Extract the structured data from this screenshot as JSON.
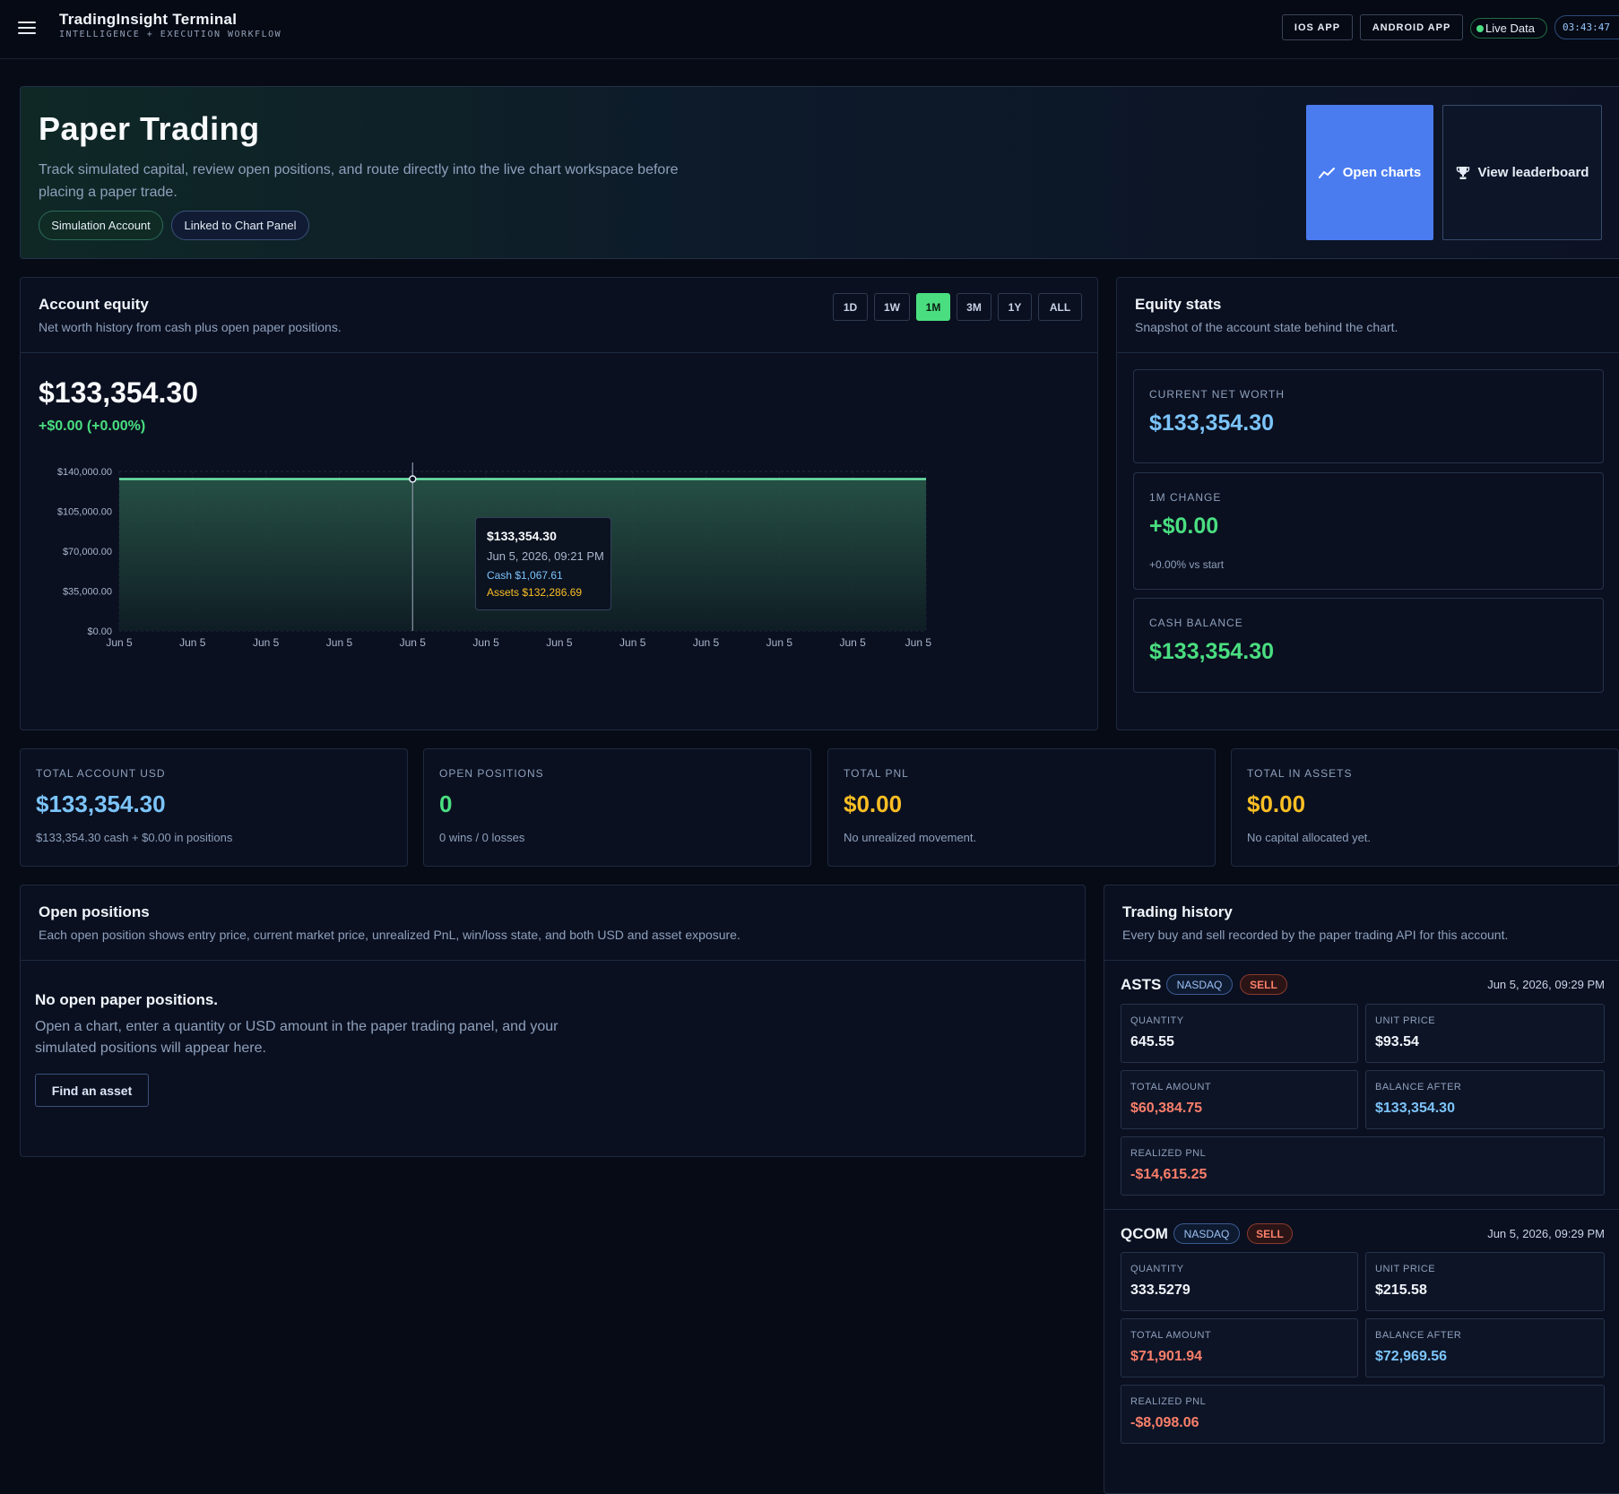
{
  "header": {
    "title": "TradingInsight Terminal",
    "subtitle": "INTELLIGENCE + EXECUTION WORKFLOW",
    "ios_label": "IOS APP",
    "android_label": "ANDROID APP",
    "live_label": "Live Data",
    "clock": "03:43:47"
  },
  "hero": {
    "title": "Paper Trading",
    "description": "Track simulated capital, review open positions, and route directly into the live chart workspace before placing a paper trade.",
    "pill_sim": "Simulation Account",
    "pill_link": "Linked to Chart Panel",
    "open_charts": "Open charts",
    "view_leaderboard": "View leaderboard"
  },
  "equity": {
    "title": "Account equity",
    "subtitle": "Net worth history from cash plus open paper positions.",
    "ranges": [
      "1D",
      "1W",
      "1M",
      "3M",
      "1Y",
      "ALL"
    ],
    "active_range": "1M",
    "value": "$133,354.30",
    "change": "+$0.00 (+0.00%)",
    "tooltip": {
      "value": "$133,354.30",
      "date": "Jun 5, 2026, 09:21 PM",
      "cash": "Cash $1,067.61",
      "assets": "Assets $132,286.69"
    }
  },
  "chart_data": {
    "type": "area",
    "x": [
      "Jun 5",
      "Jun 5",
      "Jun 5",
      "Jun 5",
      "Jun 5",
      "Jun 5",
      "Jun 5",
      "Jun 5",
      "Jun 5",
      "Jun 5",
      "Jun 5",
      "Jun 5"
    ],
    "values": [
      133354.3,
      133354.3,
      133354.3,
      133354.3,
      133354.3,
      133354.3,
      133354.3,
      133354.3,
      133354.3,
      133354.3,
      133354.3,
      133354.3
    ],
    "y_ticks": [
      "$140,000.00",
      "$105,000.00",
      "$70,000.00",
      "$35,000.00",
      "$0.00"
    ],
    "y_tick_values": [
      140000,
      105000,
      70000,
      35000,
      0
    ],
    "ylim": [
      0,
      140000
    ],
    "grid": true,
    "line_color": "#6ee7a8",
    "hover_index": 4
  },
  "stats": {
    "title": "Equity stats",
    "subtitle": "Snapshot of the account state behind the chart.",
    "net_worth_label": "CURRENT NET WORTH",
    "net_worth": "$133,354.30",
    "change_label": "1M CHANGE",
    "change": "+$0.00",
    "change_note": "+0.00% vs start",
    "cash_label": "CASH BALANCE",
    "cash": "$133,354.30"
  },
  "summary": [
    {
      "label": "TOTAL ACCOUNT USD",
      "value": "$133,354.30",
      "note": "$133,354.30 cash + $0.00 in positions"
    },
    {
      "label": "OPEN POSITIONS",
      "value": "0",
      "note": "0 wins / 0 losses"
    },
    {
      "label": "TOTAL PNL",
      "value": "$0.00",
      "note": "No unrealized movement."
    },
    {
      "label": "TOTAL IN ASSETS",
      "value": "$0.00",
      "note": "No capital allocated yet."
    }
  ],
  "positions": {
    "title": "Open positions",
    "subtitle": "Each open position shows entry price, current market price, unrealized PnL, win/loss state, and both USD and asset exposure.",
    "empty_title": "No open paper positions.",
    "empty_desc": "Open a chart, enter a quantity or USD amount in the paper trading panel, and your simulated positions will appear here.",
    "find_label": "Find an asset"
  },
  "history": {
    "title": "Trading history",
    "subtitle": "Every buy and sell recorded by the paper trading API for this account.",
    "labels": {
      "quantity": "QUANTITY",
      "unit_price": "UNIT PRICE",
      "total": "TOTAL AMOUNT",
      "balance": "BALANCE AFTER",
      "pnl": "REALIZED PNL"
    },
    "trades": [
      {
        "symbol": "ASTS",
        "exchange": "NASDAQ",
        "side": "SELL",
        "date": "Jun 5, 2026, 09:29 PM",
        "quantity": "645.55",
        "unit_price": "$93.54",
        "total": "$60,384.75",
        "balance": "$133,354.30",
        "pnl": "-$14,615.25"
      },
      {
        "symbol": "QCOM",
        "exchange": "NASDAQ",
        "side": "SELL",
        "date": "Jun 5, 2026, 09:29 PM",
        "quantity": "333.5279",
        "unit_price": "$215.58",
        "total": "$71,901.94",
        "balance": "$72,969.56",
        "pnl": "-$8,098.06"
      }
    ]
  }
}
